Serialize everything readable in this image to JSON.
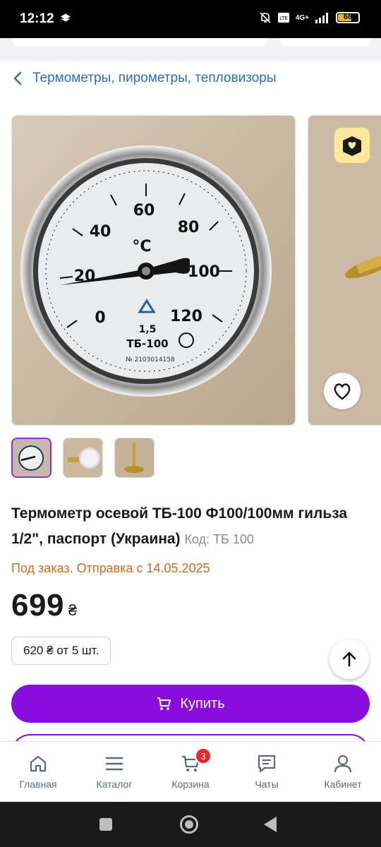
{
  "status_bar": {
    "time": "12:12",
    "network": "4G+",
    "battery": "68"
  },
  "breadcrumb": {
    "label": "Термометры, пирометры, тепловизоры"
  },
  "gauge": {
    "ticks": [
      "0",
      "20",
      "40",
      "60",
      "80",
      "100",
      "120"
    ],
    "unit": "°C",
    "accuracy": "1,5",
    "model": "ТБ-100",
    "serial": "№ 2103014158"
  },
  "product": {
    "title": "Термометр осевой ТБ-100 Ф100/100мм гильза 1/2\", паспорт (Украина)",
    "code": "Код: ТБ 100",
    "status": "Под заказ. Отправка с 14.05.2025",
    "price": "699",
    "currency": "₴",
    "wholesale": "620 ₴ от 5 шт.",
    "buy_label": "Купить"
  },
  "bottom_nav": {
    "items": [
      {
        "label": "Главная",
        "icon": "home-icon"
      },
      {
        "label": "Каталог",
        "icon": "menu-icon"
      },
      {
        "label": "Корзина",
        "icon": "cart-icon"
      },
      {
        "label": "Чаты",
        "icon": "chat-icon"
      },
      {
        "label": "Кабинет",
        "icon": "user-icon"
      }
    ],
    "cart_count": "3"
  },
  "colors": {
    "accent": "#8a0de0",
    "link": "#2f6fb5",
    "status": "#d2691e",
    "badge": "#e8262b"
  }
}
